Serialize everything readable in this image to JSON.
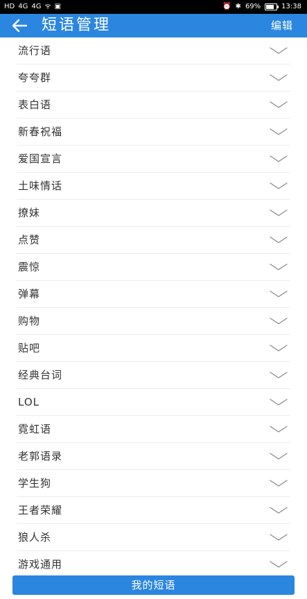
{
  "status_bar": {
    "left_icons": [
      "HD",
      "4G",
      "4G",
      "wifi-icon",
      "notification-icon"
    ],
    "battery": "69%",
    "time": "13:38"
  },
  "app_bar": {
    "title": "短语管理",
    "edit_label": "编辑"
  },
  "categories": [
    {
      "label": "流行语"
    },
    {
      "label": "夸夸群"
    },
    {
      "label": "表白语"
    },
    {
      "label": "新春祝福"
    },
    {
      "label": "爱国宣言"
    },
    {
      "label": "土味情话"
    },
    {
      "label": "撩妹"
    },
    {
      "label": "点赞"
    },
    {
      "label": "震惊"
    },
    {
      "label": "弹幕"
    },
    {
      "label": "购物"
    },
    {
      "label": "贴吧"
    },
    {
      "label": "经典台词"
    },
    {
      "label": "LOL"
    },
    {
      "label": "霓虹语"
    },
    {
      "label": "老郭语录"
    },
    {
      "label": "学生狗"
    },
    {
      "label": "王者荣耀"
    },
    {
      "label": "狼人杀"
    },
    {
      "label": "游戏通用"
    }
  ],
  "bottom_button": {
    "label": "我的短语"
  },
  "colors": {
    "accent": "#2b86e0",
    "text": "#333333",
    "divider": "#ececec"
  }
}
